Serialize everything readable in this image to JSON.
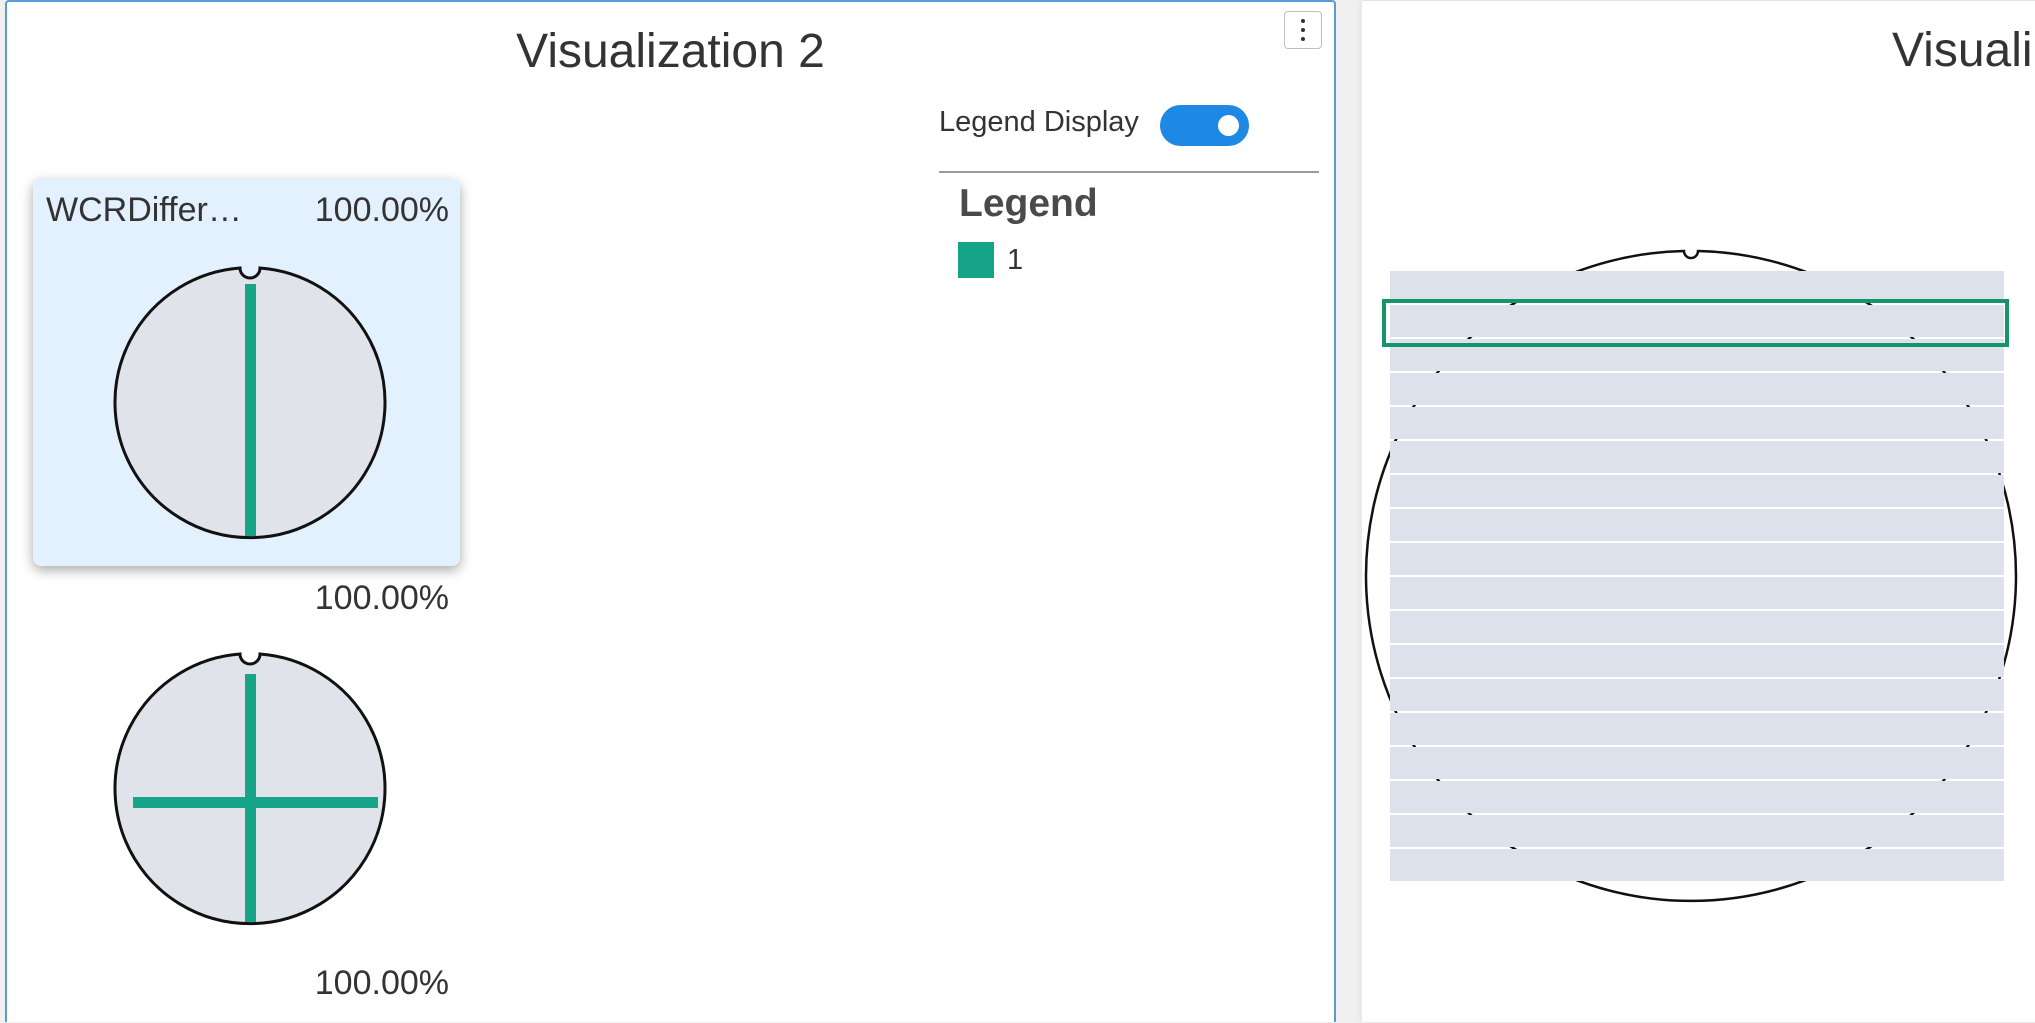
{
  "panels": {
    "left": {
      "title": "Visualization 2",
      "legend_toggle": {
        "label": "Legend Display",
        "on": true
      },
      "legend": {
        "title": "Legend",
        "items": [
          {
            "label": "1",
            "color": "#17a589"
          }
        ]
      },
      "wafers": [
        {
          "name": "WCRDiffer…",
          "percent": "100.00%",
          "selected": true,
          "pattern": "vertical-line"
        },
        {
          "name": "",
          "percent": "100.00%",
          "selected": false,
          "pattern": "cross"
        },
        {
          "name": "",
          "percent": "100.00%",
          "selected": false,
          "pattern": ""
        }
      ]
    },
    "right": {
      "title": "Visuali"
    }
  },
  "colors": {
    "accent_blue": "#1e88e5",
    "panel_border": "#5b9bd5",
    "defect_green": "#17a589",
    "highlight_green": "#16956a",
    "wafer_fill": "#e0e3ea",
    "card_bg": "#e3f0fd",
    "rows_fill": "#dde1ec"
  },
  "icons": {
    "menu": "kebab-menu-icon"
  }
}
